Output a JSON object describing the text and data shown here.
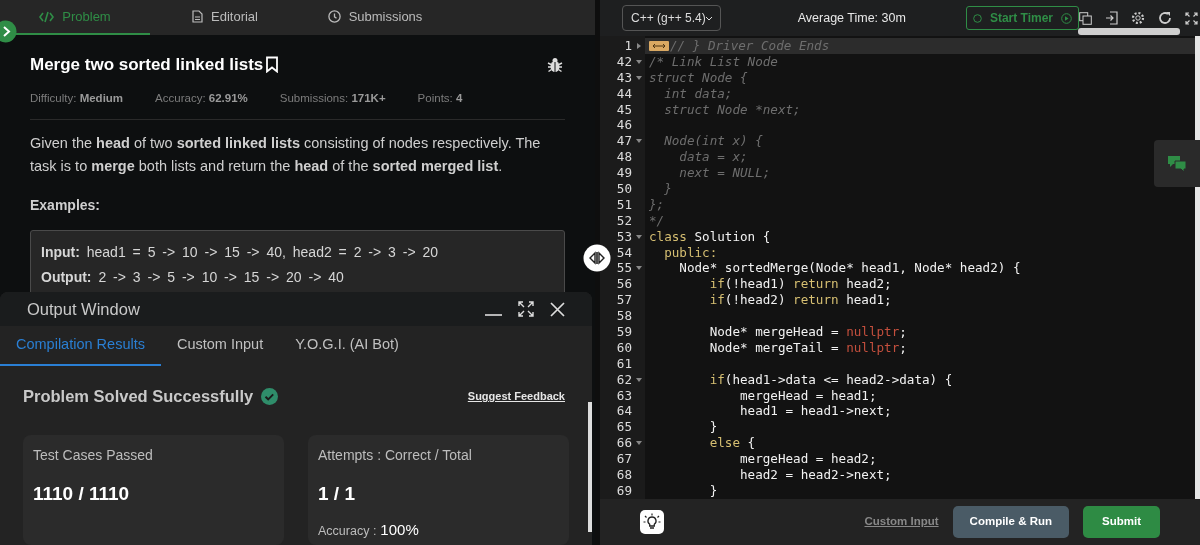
{
  "problem_tabs": [
    {
      "label": "Problem",
      "selected": true
    },
    {
      "label": "Editorial",
      "selected": false
    },
    {
      "label": "Submissions",
      "selected": false
    }
  ],
  "problem": {
    "title": "Merge two sorted linked lists",
    "meta": [
      "Difficulty: **Medium**",
      "Accuracy: **62.91%**",
      "Submissions: **171K+**",
      "Points: **4**"
    ],
    "statement": "Given the **head** of two **sorted linked lists** consisting of nodes respectively. The task is to **merge** both lists and return the **head** of the **sorted merged list**.",
    "examples_heading": "Examples:",
    "example_lines": [
      "**Input:** head1 = 5 -> 10 -> 15 -> 40, head2 = 2 -> 3 -> 20",
      "**Output:** 2 -> 3 -> 5 -> 10 -> 15 -> 20 -> 40"
    ]
  },
  "output_window": {
    "title": "Output Window",
    "tabs": [
      {
        "label": "Compilation Results",
        "selected": true
      },
      {
        "label": "Custom Input",
        "selected": false
      },
      {
        "label": "Y.O.G.I. (AI Bot)",
        "selected": false
      }
    ],
    "status": "Problem Solved Successfully",
    "feedback_link": "Suggest Feedback",
    "cards": [
      {
        "title": "Test Cases Passed",
        "value": "1110 / 1110"
      },
      {
        "title": "Attempts : Correct / Total",
        "value": "1 / 1",
        "accuracy_label": "Accuracy :",
        "accuracy_value": "100%"
      }
    ]
  },
  "editor": {
    "language": "C++ (g++ 5.4)",
    "average_time": "Average Time: 30m",
    "timer_button": "Start Timer",
    "lines": [
      {
        "n": "1",
        "foldable": true,
        "collapsed": true,
        "active": true,
        "tokens": [
          {
            "kind": "comment",
            "text": "// } Driver Code Ends"
          }
        ]
      },
      {
        "n": "42",
        "foldable": true,
        "collapsed": false,
        "active": false,
        "tokens": [
          {
            "kind": "comment",
            "text": "/* Link List Node"
          }
        ]
      },
      {
        "n": "43",
        "foldable": true,
        "collapsed": false,
        "active": false,
        "tokens": [
          {
            "kind": "comment",
            "text": "struct Node {"
          }
        ]
      },
      {
        "n": "44",
        "foldable": false,
        "active": false,
        "tokens": [
          {
            "kind": "comment",
            "text": "  int data;"
          }
        ]
      },
      {
        "n": "45",
        "foldable": false,
        "active": false,
        "tokens": [
          {
            "kind": "comment",
            "text": "  struct Node *next;"
          }
        ]
      },
      {
        "n": "46",
        "foldable": false,
        "active": false
      },
      {
        "n": "47",
        "foldable": true,
        "collapsed": false,
        "active": false,
        "tokens": [
          {
            "kind": "comment",
            "text": "  Node(int x) {"
          }
        ]
      },
      {
        "n": "48",
        "foldable": false,
        "active": false,
        "tokens": [
          {
            "kind": "comment",
            "text": "    data = x;"
          }
        ]
      },
      {
        "n": "49",
        "foldable": false,
        "active": false,
        "tokens": [
          {
            "kind": "comment",
            "text": "    next = NULL;"
          }
        ]
      },
      {
        "n": "50",
        "foldable": false,
        "active": false,
        "tokens": [
          {
            "kind": "comment",
            "text": "  }"
          }
        ]
      },
      {
        "n": "51",
        "foldable": false,
        "active": false,
        "tokens": [
          {
            "kind": "comment",
            "text": "};"
          }
        ]
      },
      {
        "n": "52",
        "foldable": false,
        "active": false,
        "tokens": [
          {
            "kind": "comment",
            "text": "*/"
          }
        ]
      },
      {
        "n": "53",
        "foldable": true,
        "collapsed": false,
        "active": false,
        "tokens": [
          {
            "kind": "keyword",
            "text": "class"
          },
          {
            "kind": "plain",
            "text": " Solution {"
          }
        ]
      },
      {
        "n": "54",
        "foldable": false,
        "active": false,
        "tokens": [
          {
            "kind": "keyword",
            "text": "  public:"
          }
        ]
      },
      {
        "n": "55",
        "foldable": true,
        "collapsed": false,
        "active": false,
        "tokens": [
          {
            "kind": "plain",
            "text": "    Node* sortedMerge(Node* head1, Node* head2) {"
          }
        ]
      },
      {
        "n": "56",
        "foldable": false,
        "active": false,
        "tokens": [
          {
            "kind": "keyword",
            "text": "        if"
          },
          {
            "kind": "plain",
            "text": "(!head1) "
          },
          {
            "kind": "keyword",
            "text": "return"
          },
          {
            "kind": "plain",
            "text": " head2;"
          }
        ]
      },
      {
        "n": "57",
        "foldable": false,
        "active": false,
        "tokens": [
          {
            "kind": "keyword",
            "text": "        if"
          },
          {
            "kind": "plain",
            "text": "(!head2) "
          },
          {
            "kind": "keyword",
            "text": "return"
          },
          {
            "kind": "plain",
            "text": " head1;"
          }
        ]
      },
      {
        "n": "58",
        "foldable": false,
        "active": false
      },
      {
        "n": "59",
        "foldable": false,
        "active": false,
        "tokens": [
          {
            "kind": "plain",
            "text": "        Node* mergeHead = "
          },
          {
            "kind": "literal",
            "text": "nullptr"
          },
          {
            "kind": "plain",
            "text": ";"
          }
        ]
      },
      {
        "n": "60",
        "foldable": false,
        "active": false,
        "tokens": [
          {
            "kind": "plain",
            "text": "        Node* mergeTail = "
          },
          {
            "kind": "literal",
            "text": "nullptr"
          },
          {
            "kind": "plain",
            "text": ";"
          }
        ]
      },
      {
        "n": "61",
        "foldable": false,
        "active": false
      },
      {
        "n": "62",
        "foldable": true,
        "collapsed": false,
        "active": false,
        "tokens": [
          {
            "kind": "keyword",
            "text": "        if"
          },
          {
            "kind": "plain",
            "text": "(head1->data <= head2->data) {"
          }
        ]
      },
      {
        "n": "63",
        "foldable": false,
        "active": false,
        "tokens": [
          {
            "kind": "plain",
            "text": "            mergeHead = head1;"
          }
        ]
      },
      {
        "n": "64",
        "foldable": false,
        "active": false,
        "tokens": [
          {
            "kind": "plain",
            "text": "            head1 = head1->next;"
          }
        ]
      },
      {
        "n": "65",
        "foldable": false,
        "active": false,
        "tokens": [
          {
            "kind": "plain",
            "text": "        }"
          }
        ]
      },
      {
        "n": "66",
        "foldable": true,
        "collapsed": false,
        "active": false,
        "tokens": [
          {
            "kind": "keyword",
            "text": "        else"
          },
          {
            "kind": "plain",
            "text": " {"
          }
        ]
      },
      {
        "n": "67",
        "foldable": false,
        "active": false,
        "tokens": [
          {
            "kind": "plain",
            "text": "            mergeHead = head2;"
          }
        ]
      },
      {
        "n": "68",
        "foldable": false,
        "active": false,
        "tokens": [
          {
            "kind": "plain",
            "text": "            head2 = head2->next;"
          }
        ]
      },
      {
        "n": "69",
        "foldable": false,
        "active": false,
        "tokens": [
          {
            "kind": "plain",
            "text": "        }"
          }
        ]
      }
    ]
  },
  "footer": {
    "custom_input": "Custom Input",
    "compile_button": "Compile & Run",
    "submit_button": "Submit"
  }
}
